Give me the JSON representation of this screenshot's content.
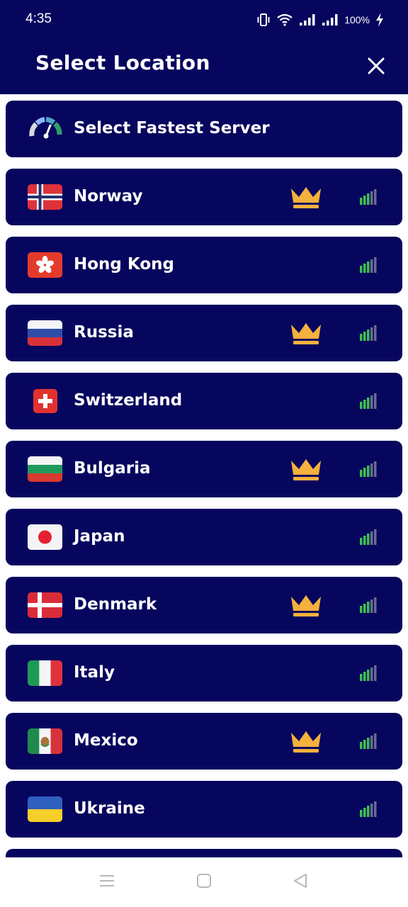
{
  "status_bar": {
    "time": "4:35",
    "battery": "100%"
  },
  "header": {
    "title": "Select Location"
  },
  "fastest": {
    "label": "Select Fastest Server"
  },
  "locations": [
    {
      "name": "Norway",
      "flag": "norway-flag",
      "premium": true
    },
    {
      "name": "Hong Kong",
      "flag": "hong-kong-flag",
      "premium": false
    },
    {
      "name": "Russia",
      "flag": "russia-flag",
      "premium": true
    },
    {
      "name": "Switzerland",
      "flag": "switzerland-flag",
      "premium": false
    },
    {
      "name": "Bulgaria",
      "flag": "bulgaria-flag",
      "premium": true
    },
    {
      "name": "Japan",
      "flag": "japan-flag",
      "premium": false
    },
    {
      "name": "Denmark",
      "flag": "denmark-flag",
      "premium": true
    },
    {
      "name": "Italy",
      "flag": "italy-flag",
      "premium": false
    },
    {
      "name": "Mexico",
      "flag": "mexico-flag",
      "premium": true
    },
    {
      "name": "Ukraine",
      "flag": "ukraine-flag",
      "premium": false
    }
  ],
  "colors": {
    "background": "#06065e",
    "crown": "#f5b13d",
    "signal": "#3fbf4f"
  },
  "icons": [
    "speedometer-icon",
    "crown-icon",
    "signal-icon",
    "close-icon"
  ]
}
